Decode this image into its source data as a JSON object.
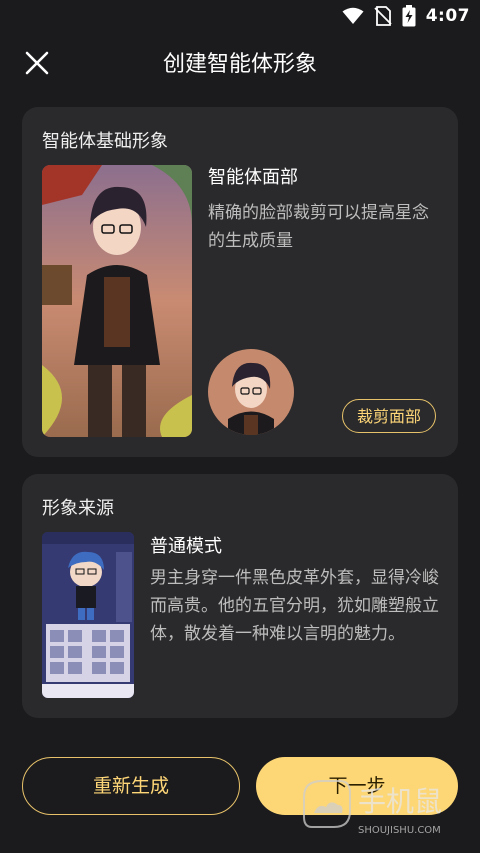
{
  "status_bar": {
    "time": "4:07",
    "icons": [
      "wifi-icon",
      "no-sim-icon",
      "battery-charging-icon"
    ]
  },
  "header": {
    "title": "创建智能体形象",
    "close_icon": "close-icon"
  },
  "basic_image": {
    "section_title": "智能体基础形象",
    "face_title": "智能体面部",
    "face_desc": "精确的脸部裁剪可以提高星念的生成质量",
    "crop_button": "裁剪面部"
  },
  "source": {
    "section_title": "形象来源",
    "mode_title": "普通模式",
    "mode_desc": "男主身穿一件黑色皮革外套，显得冷峻而高贵。他的五官分明，犹如雕塑般立体，散发着一种难以言明的魅力。"
  },
  "actions": {
    "regenerate": "重新生成",
    "next": "下一步"
  },
  "watermark": {
    "brand": "手机鼠",
    "url": "SHOUJISHU.COM"
  },
  "colors": {
    "background": "#1b1b1d",
    "card": "#2a2a2c",
    "accent": "#fdd676",
    "accent_border": "#e7c26a"
  }
}
